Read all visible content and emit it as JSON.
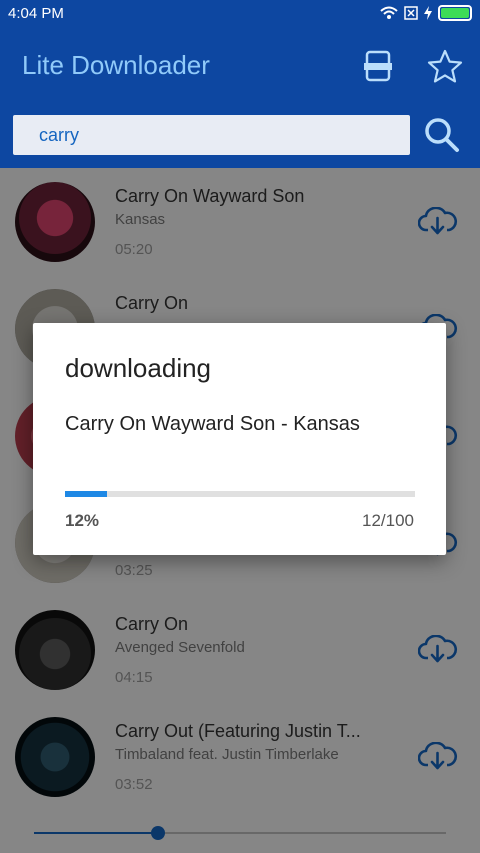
{
  "status": {
    "time": "4:04 PM"
  },
  "app": {
    "title": "Lite Downloader"
  },
  "search": {
    "query": "carry"
  },
  "songs": [
    {
      "title": "Carry On Wayward Son",
      "artist": "Kansas",
      "duration": "05:20"
    },
    {
      "title": "Carry On",
      "artist": "",
      "duration": ""
    },
    {
      "title": "",
      "artist": "",
      "duration": ""
    },
    {
      "title": "",
      "artist": "",
      "duration": "03:25"
    },
    {
      "title": "Carry On",
      "artist": "Avenged Sevenfold",
      "duration": "04:15"
    },
    {
      "title": "Carry Out (Featuring Justin T...",
      "artist": "Timbaland feat. Justin Timberlake",
      "duration": "03:52"
    }
  ],
  "player": {
    "seek_fraction": 0.3
  },
  "dialog": {
    "title": "downloading",
    "message": "Carry On Wayward Son - Kansas",
    "progress_fraction": 0.12,
    "percent_label": "12%",
    "count_label": "12/100"
  },
  "colors": {
    "primary": "#0d47a1",
    "accent": "#1565c0",
    "battery": "#3ddc57"
  },
  "icons": [
    "wifi-icon",
    "sim-icon",
    "charging-icon",
    "battery-icon",
    "storage-icon",
    "star-icon",
    "search-icon",
    "cloud-download-icon"
  ]
}
